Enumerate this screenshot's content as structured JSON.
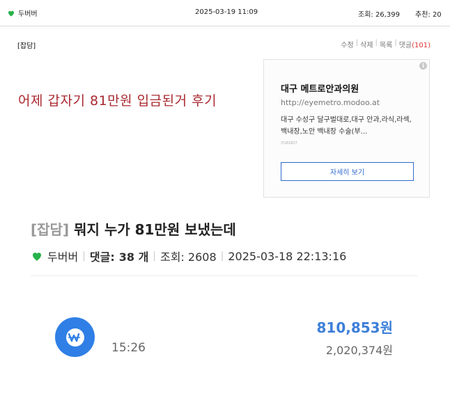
{
  "header": {
    "author": "두버버",
    "date": "2025-03-19 11:09",
    "views": "조회: 26,399",
    "recommend": "추천: 20"
  },
  "post": {
    "category": "[잡담]",
    "title": "어제 갑자기 81만원 입금된거 후기"
  },
  "actions": {
    "edit": "수정",
    "delete": "삭제",
    "list": "목록",
    "comment": "댓글",
    "comment_count": "(101)"
  },
  "ad": {
    "info": "i",
    "title": "대구 메트로안과의원",
    "url": "http://eyemetro.modoo.at",
    "desc": "대구 수성구 달구벌대로,대구 안과,라식,라섹,백내장,노안 백내장 수술(부...",
    "code": "의181827",
    "button": "자세히 보기"
  },
  "embedded": {
    "category": "[잡담]",
    "title": "뭐지 누가 81만원 보냈는데",
    "author": "두버버",
    "comments_label": "댓글:",
    "comments_value": "38 개",
    "views": "조회: 2608",
    "datetime": "2025-03-18 22:13:16"
  },
  "transaction": {
    "time": "15:26",
    "amount": "810,853원",
    "balance": "2,020,374원"
  },
  "colors": {
    "heart": "#27b24a",
    "title_red": "#a9282f",
    "accent_blue": "#2f7fe6"
  }
}
